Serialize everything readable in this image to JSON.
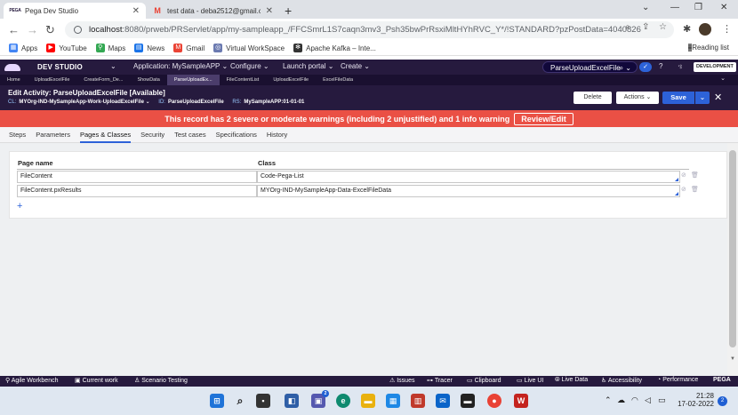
{
  "browser": {
    "tabs": [
      {
        "favicon": "PEGA",
        "title": "Pega Dev Studio"
      },
      {
        "favicon": "M",
        "title": "test data - deba2512@gmail.com"
      }
    ],
    "new_tab": "+",
    "window": {
      "minimize": "⌄",
      "restore": "—",
      "maximize": "❐",
      "close": "✕"
    },
    "nav": {
      "back": "←",
      "forward": "→",
      "reload": "↻"
    },
    "url_host": "localhost",
    "url_rest": ":8080/prweb/PRServlet/app/my-sampleapp_/FFCSmrL1S7caqn3mv3_Psh35bwPrRsxiMltHYhRVC_Y*/!STANDARD?pzPostData=4040826",
    "bookmarks": [
      {
        "icon": "apps-icon",
        "label": "Apps",
        "color": "#4285f4"
      },
      {
        "icon": "youtube-icon",
        "label": "YouTube",
        "color": "#ff0000"
      },
      {
        "icon": "maps-icon",
        "label": "Maps",
        "color": "#34a853"
      },
      {
        "icon": "news-icon",
        "label": "News",
        "color": "#1a73e8"
      },
      {
        "icon": "gmail-icon",
        "label": "Gmail",
        "color": "#ea4335"
      },
      {
        "icon": "virtual-workspace-icon",
        "label": "Virtual WorkSpace",
        "color": "#6b7ab0"
      },
      {
        "icon": "kafka-icon",
        "label": "Apache Kafka – Inte...",
        "color": "#333333"
      }
    ],
    "reading_list": "Reading list"
  },
  "pega": {
    "studio": "DEV STUDIO",
    "application_label": "Application:",
    "application_value": "MySampleAPP",
    "menus": [
      "Configure",
      "Launch portal",
      "Create"
    ],
    "search_value": "ParseUploadExcelFile",
    "dev_badge": "DEVELOPMENT",
    "tabs": [
      "Home",
      "UploadExcelFile",
      "CreateForm_De...",
      "ShowData",
      "ParseUploadEx...",
      "FileContentList",
      "UploadExcelFile",
      "ExcelFileData"
    ],
    "active_tab": 4
  },
  "rule": {
    "title": "Edit  Activity: ParseUploadExcelFile [Available]",
    "cl_label": "CL:",
    "cl_value": "MYOrg-IND-MySampleApp-Work-UploadExcelFile ⌄",
    "id_label": "ID:",
    "id_value": "ParseUploadExcelFile",
    "rs_label": "RS:",
    "rs_value": "MySampleAPP:01-01-01",
    "delete": "Delete",
    "actions": "Actions ⌄",
    "save": "Save",
    "save_more": "⌄",
    "close": "✕"
  },
  "warning": {
    "text": "This record has 2 severe or moderate warnings (including 2 unjustified) and 1 info warning",
    "review": "Review/Edit"
  },
  "form_tabs": [
    "Steps",
    "Parameters",
    "Pages & Classes",
    "Security",
    "Test cases",
    "Specifications",
    "History"
  ],
  "active_form_tab": 2,
  "grid": {
    "col_page": "Page name",
    "col_class": "Class",
    "rows": [
      {
        "page": "FileContent",
        "class": "Code-Pega-List"
      },
      {
        "page": "FileContent.pxResults",
        "class": "MYOrg-IND-MySampleApp-Data-ExcelFileData"
      }
    ],
    "add": "+"
  },
  "footer": {
    "left": [
      "Agile Workbench",
      "Current work",
      "Scenario Testing"
    ],
    "right": [
      "Issues",
      "Tracer",
      "Clipboard",
      "Live UI",
      "Live Data",
      "Accessibility",
      "Performance"
    ],
    "brand": "PEGA"
  },
  "taskbar": {
    "time": "21:28",
    "date": "17-02-2022",
    "notifications": "2",
    "badge": "2"
  }
}
